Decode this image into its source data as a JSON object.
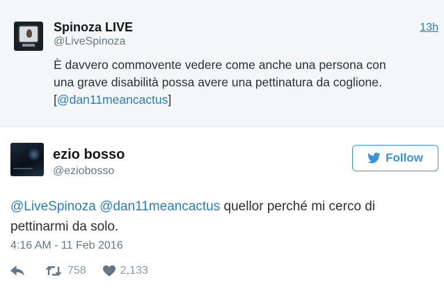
{
  "quoted_tweet": {
    "name": "Spinoza LIVE",
    "handle": "@LiveSpinoza",
    "time": "13h",
    "text_line1": "È davvero commovente vedere come anche una persona con",
    "text_line2": "una grave disabilità possa avere una pettinatura da coglione.",
    "bracket_open": "[",
    "mention": "@dan11meancactus",
    "bracket_close": "]"
  },
  "tweet": {
    "name": "ezio bosso",
    "handle": "@eziobosso",
    "follow_label": "Follow",
    "mention1": "@LiveSpinoza",
    "mention2": "@dan11meancactus",
    "text_after": " quellor perché mi cerco di",
    "text_line2": "pettinarmi da solo.",
    "timestamp": "4:16 AM - 11 Feb 2016",
    "retweets": "758",
    "likes": "2,133"
  },
  "icons": {
    "reply": "reply-icon",
    "retweet": "retweet-icon",
    "like": "heart-icon",
    "follow_bird": "twitter-bird-icon"
  },
  "colors": {
    "link": "#2b7bb9",
    "follow": "#3b94d9",
    "quoted_bg": "#f5f8fa",
    "muted": "#657786",
    "action": "#8899a6"
  }
}
